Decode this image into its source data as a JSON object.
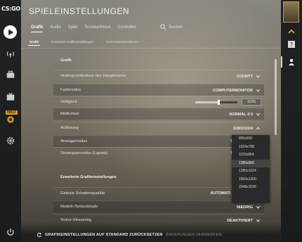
{
  "app": {
    "logo_text": "CS:GO",
    "title": "SPIELEINSTELLUNGEN"
  },
  "left_rail": {
    "new_badge": "NEU"
  },
  "tabs": [
    {
      "label": "Grafik",
      "active": true
    },
    {
      "label": "Audio",
      "active": false
    },
    {
      "label": "Spiel",
      "active": false
    },
    {
      "label": "Testatur/Maus",
      "active": false
    },
    {
      "label": "Controller",
      "active": false
    }
  ],
  "search": {
    "label": "Suchen"
  },
  "subtabs": [
    {
      "label": "Grafik",
      "active": true
    },
    {
      "label": "Erweiterte Grafikeinstellungen",
      "active": false
    },
    {
      "label": "HUD-Kantenpositionen",
      "active": false
    }
  ],
  "sections": {
    "graphics": "Grafik",
    "advanced": "Erweiterte Grafikeinstellungen"
  },
  "rows": {
    "menu_bg": {
      "label": "Hintergrundkulisse des Hauptmenüs",
      "value": "COUNTY"
    },
    "color_mode": {
      "label": "Farbmodus",
      "value": "COMPUTERMONITOR"
    },
    "brightness": {
      "label": "Helligkeit",
      "value": "110%",
      "fill_fraction": 0.55
    },
    "aspect": {
      "label": "Bildformat",
      "value": "NORMAL 4:3"
    },
    "resolution": {
      "label": "Auflösung",
      "value": "1280X1024"
    },
    "display_mode": {
      "label": "Anzeigemodus",
      "value": "DE"
    },
    "power_mode": {
      "label": "Stromsparmodus (Laptop)",
      "value": "DE"
    },
    "shadow": {
      "label": "Globale Schattenqualität",
      "value": "AUTOMATI"
    },
    "model_detail": {
      "label": "Modell-/Texturdetails",
      "value": "NIEDRIG"
    },
    "texture_stream": {
      "label": "Textur-Streaming",
      "value": "DEAKTIVIERT"
    }
  },
  "resolution_options": [
    {
      "label": "800x600",
      "selected": false
    },
    {
      "label": "1024x768",
      "selected": false
    },
    {
      "label": "1152x864",
      "selected": false
    },
    {
      "label": "1280x960",
      "selected": true
    },
    {
      "label": "1280x1024",
      "selected": false
    },
    {
      "label": "1600x1200",
      "selected": false
    },
    {
      "label": "2048x1536",
      "selected": false
    }
  ],
  "footer": {
    "reset_label": "GRAFIKEINSTELLUNGEN AUF STANDARD ZURÜCKSETZEN",
    "discard_label": "ÄNDERUNGEN VERWERFEN"
  },
  "colors": {
    "accent_badge": "#e8a020",
    "panel_text": "#e0e0e0"
  }
}
